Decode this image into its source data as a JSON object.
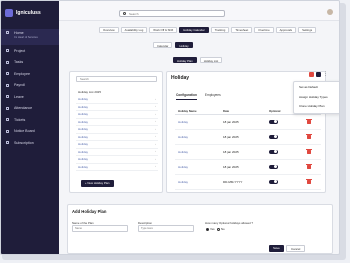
{
  "brand": {
    "name": "Igniculuss"
  },
  "search": {
    "placeholder": "Search"
  },
  "sidebar": {
    "items": [
      {
        "label": "Home",
        "sub": "Cx Heart of Services",
        "icon": "home-icon"
      },
      {
        "label": "Project",
        "icon": "project-icon"
      },
      {
        "label": "Tasks",
        "icon": "tasks-icon"
      },
      {
        "label": "Employee",
        "icon": "employee-icon"
      },
      {
        "label": "Payroll",
        "icon": "payroll-icon"
      },
      {
        "label": "Leave",
        "icon": "leave-icon"
      },
      {
        "label": "Attendance",
        "icon": "attendance-icon"
      },
      {
        "label": "Tickets",
        "icon": "tickets-icon"
      },
      {
        "label": "Notice Board",
        "icon": "notice-board-icon"
      },
      {
        "label": "Subscription",
        "icon": "subscription-icon"
      }
    ]
  },
  "tabs": [
    "Overview",
    "Availability Log",
    "Work Off & Shift",
    "Holiday Calendar",
    "Tracking",
    "Timesheet",
    "Overtime",
    "Approvals",
    "Settings"
  ],
  "subtabs": {
    "calendar": "Calendar",
    "holiday": "Holiday"
  },
  "hp_tabs": {
    "plan": "Holiday Plan",
    "list": "Holiday List"
  },
  "list_panel": {
    "search_placeholder": "Search",
    "header": "Holiday List 2025",
    "items": [
      "Holiday",
      "Holiday",
      "Holiday",
      "Holiday",
      "Holiday",
      "Holiday",
      "Holiday",
      "Holiday",
      "Holiday",
      "Holiday"
    ],
    "new_button": "+ New Holiday Plan"
  },
  "detail": {
    "title": "Holiday",
    "tabs": [
      "Configuration",
      "Employees"
    ],
    "columns": [
      "Holiday Name",
      "Date",
      "Optional",
      "Action"
    ],
    "rows": [
      {
        "name": "Holiday",
        "date": "18 jan 2025"
      },
      {
        "name": "Holiday",
        "date": "18 jan 2025"
      },
      {
        "name": "Holiday",
        "date": "18 jan 2025"
      },
      {
        "name": "Holiday",
        "date": "18 jan 2025"
      },
      {
        "name": "Holiday",
        "date": "DD-MM-YYYY"
      }
    ]
  },
  "menu": {
    "items": [
      "Set as Default",
      "Assign Holiday Types",
      "Clone Holiday Plan"
    ]
  },
  "add_plan": {
    "title": "Add Holiday Plan",
    "name_label": "Name of the Plan",
    "name_placeholder": "Name",
    "desc_label": "Description",
    "desc_placeholder": "Type Here",
    "optional_label": "How many Optional holidays allowed ?",
    "yes": "Yes",
    "no": "No",
    "save": "Save",
    "cancel": "Cancel"
  },
  "colors": {
    "sidebar": "#1f1d3a",
    "accent": "#1f1d3a",
    "danger": "#e0483f",
    "link": "#5a6fb0"
  }
}
